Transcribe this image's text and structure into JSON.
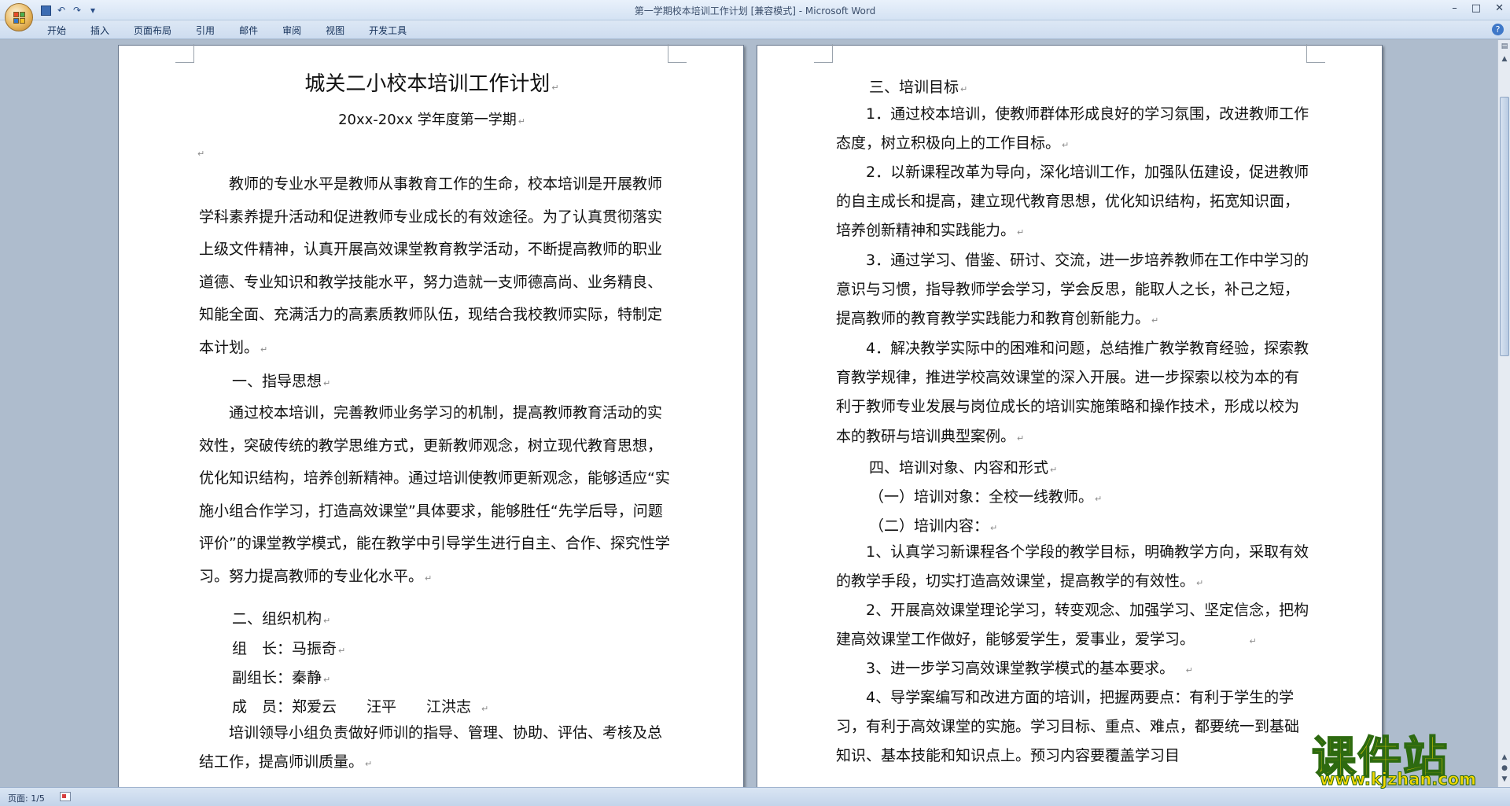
{
  "window": {
    "title": "第一学期校本培训工作计划 [兼容模式] - Microsoft Word"
  },
  "ribbon": {
    "tabs": [
      "开始",
      "插入",
      "页面布局",
      "引用",
      "邮件",
      "审阅",
      "视图",
      "开发工具"
    ]
  },
  "document": {
    "left_page": {
      "title": "城关二小校本培训工作计划",
      "subtitle": "20xx-20xx 学年度第一学期",
      "intro": "教师的专业水平是教师从事教育工作的生命，校本培训是开展教师学科素养提升活动和促进教师专业成长的有效途径。为了认真贯彻落实上级文件精神，认真开展高效课堂教育教学活动，不断提高教师的职业道德、专业知识和教学技能水平，努力造就一支师德高尚、业务精良、知能全面、充满活力的高素质教师队伍，现结合我校教师实际，特制定本计划。",
      "section1_heading": "一、指导思想",
      "section1_body": "通过校本培训，完善教师业务学习的机制，提高教师教育活动的实效性，突破传统的教学思维方式，更新教师观念，树立现代教育思想，优化知识结构，培养创新精神。通过培训使教师更新观念，能够适应“实施小组合作学习，打造高效课堂”具体要求，能够胜任“先学后导，问题评价”的课堂教学模式，能在教学中引导学生进行自主、合作、探究性学习。努力提高教师的专业化水平。",
      "section2_heading": "二、组织机构",
      "leader": "组　长：马振奇",
      "deputy": "副组长：秦静",
      "members": "成　员：郑爱云　　汪平　　江洪志",
      "section2_body": "培训领导小组负责做好师训的指导、管理、协助、评估、考核及总结工作，提高师训质量。"
    },
    "right_page": {
      "section3_heading": "三、培训目标",
      "goal1": "1．通过校本培训，使教师群体形成良好的学习氛围，改进教师工作态度，树立积极向上的工作目标。",
      "goal2": "2．以新课程改革为导向，深化培训工作，加强队伍建设，促进教师的自主成长和提高，建立现代教育思想，优化知识结构，拓宽知识面，培养创新精神和实践能力。",
      "goal3": "3．通过学习、借鉴、研讨、交流，进一步培养教师在工作中学习的意识与习惯，指导教师学会学习，学会反思，能取人之长，补己之短，提高教师的教育教学实践能力和教育创新能力。",
      "goal4": "4．解决教学实际中的困难和问题，总结推广教学教育经验，探索教育教学规律，推进学校高效课堂的深入开展。进一步探索以校为本的有利于教师专业发展与岗位成长的培训实施策略和操作技术，形成以校为本的教研与培训典型案例。",
      "section4_heading": "四、培训对象、内容和形式",
      "target": "（一）培训对象：全校一线教师。",
      "content_heading": "（二）培训内容：",
      "content1": "1、认真学习新课程各个学段的教学目标，明确教学方向，采取有效的教学手段，切实打造高效课堂，提高教学的有效性。",
      "content2": "2、开展高效课堂理论学习，转变观念、加强学习、坚定信念，把构建高效课堂工作做好，能够爱学生，爱事业，爱学习。",
      "content3": "3、进一步学习高效课堂教学模式的基本要求。",
      "content4": "4、导学案编写和改进方面的培训，把握两要点：有利于学生的学习，有利于高效课堂的实施。学习目标、重点、难点，都要统一到基础知识、基本技能和知识点上。预习内容要覆盖学习目"
    }
  },
  "status": {
    "page": "页面: 1/5"
  },
  "watermark": {
    "text": "课件站",
    "url": "www.kjzhan.com"
  }
}
